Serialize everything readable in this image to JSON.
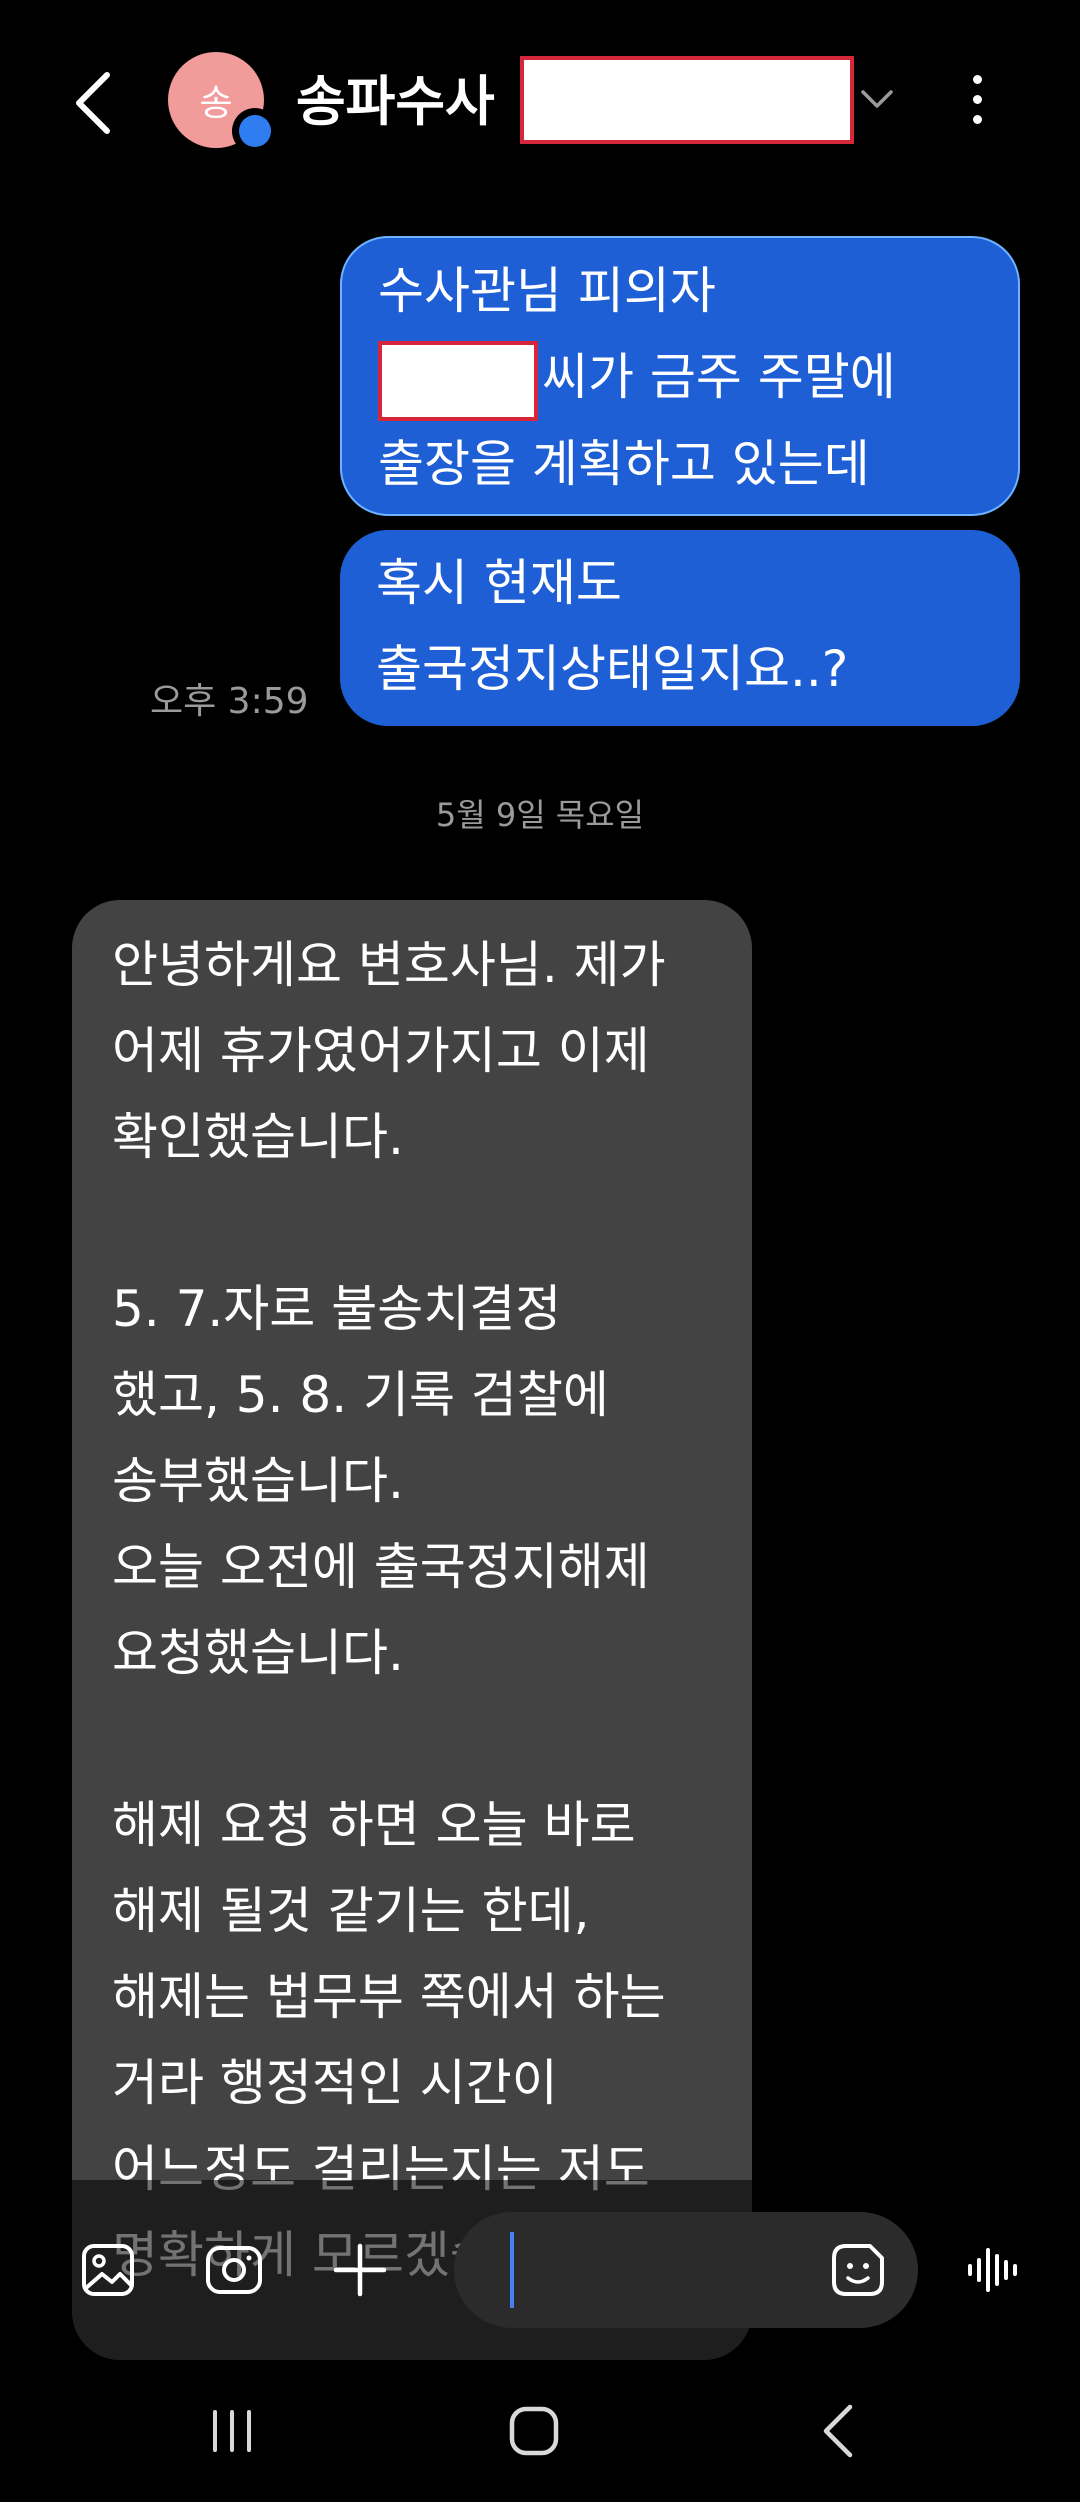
{
  "header": {
    "avatar_letter": "송",
    "title": "송파수사",
    "back_icon": "chevron-left-icon",
    "expand_icon": "chevron-down-icon",
    "more_icon": "more-vertical-icon"
  },
  "messages": {
    "sent_1": {
      "line1": "수사관님 피의자",
      "line2_suffix": "씨가 금주 주말에",
      "line3": "출장을 계획하고 있는데"
    },
    "sent_2": {
      "line1": "혹시 현재도",
      "line2": "출국정지상태일지요..?"
    },
    "sent_time": "오후 3:59",
    "date_divider": "5월 9일 목요일",
    "received_1": {
      "text": "안녕하게요 변호사님. 제가\n어제 휴가였어가지고 이제\n확인했습니다.\n\n5. 7.자로 불송치결정\n했고, 5. 8. 기록 검찰에\n송부했습니다.\n오늘 오전에 출국정지해제\n요청했습니다.\n\n해제 요청 하면 오늘 바로\n해제 될것 같기는 한데,\n해제는 법무부 쪽에서 하는\n거라 행정적인 시간이\n어느정도 걸리는지는 저도\n명확하게 모르겠습니다."
    }
  },
  "composer": {
    "gallery_icon": "image-icon",
    "camera_icon": "camera-icon",
    "add_icon": "plus-icon",
    "emoji_icon": "sticker-icon",
    "voice_icon": "voice-wave-icon",
    "input_value": ""
  },
  "navbar": {
    "recents_icon": "recents-icon",
    "home_icon": "home-icon",
    "back_icon": "back-icon"
  },
  "colors": {
    "background": "#000000",
    "sent_bubble": "#1e5fd6",
    "received_bubble": "#434343",
    "avatar": "#f29b9b",
    "redaction_border": "#d6263b"
  }
}
